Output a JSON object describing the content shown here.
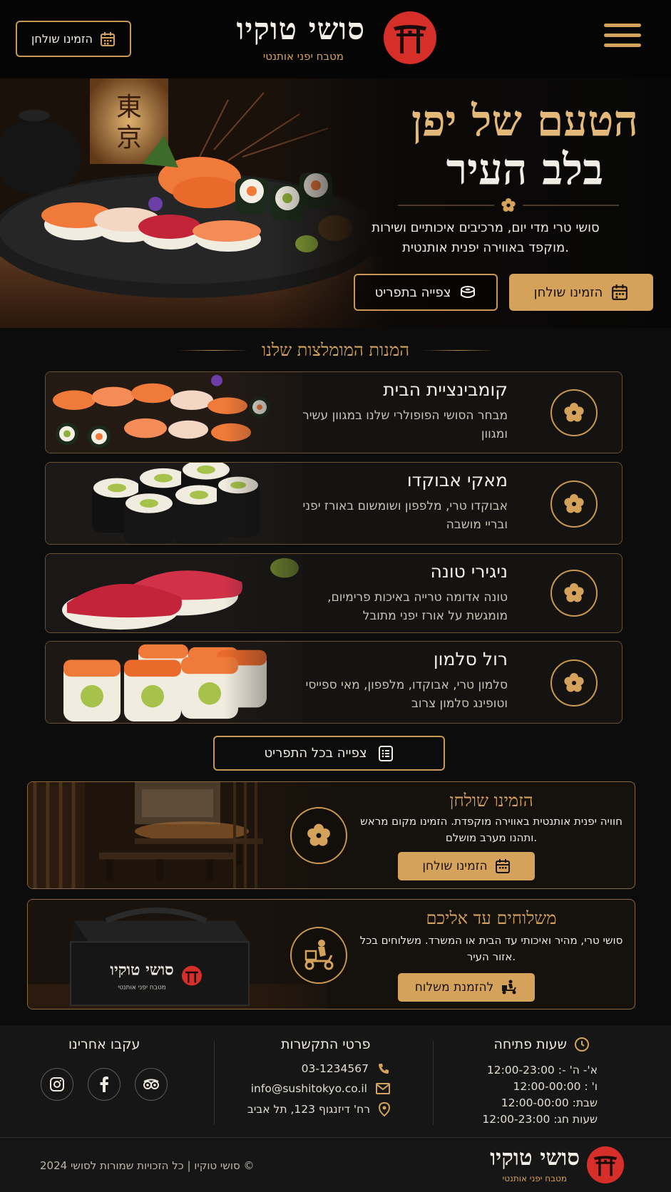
{
  "header": {
    "reserve_label": "הזמינו שולחן",
    "brand_name": "סושי טוקיו",
    "brand_tagline": "מטבח יפני אותנטי",
    "menu_icon": "hamburger-icon",
    "calendar_icon": "calendar-icon"
  },
  "hero": {
    "title_line1": "הטעם של יפן",
    "title_line2": "בלב העיר",
    "text": "סושי טרי מדי יום, מרכיבים איכותיים ושירות מוקפד באווירה יפנית אותנטית.",
    "reserve_label": "הזמינו שולחן",
    "menu_label": "צפייה בתפריט"
  },
  "featured": {
    "title": "המנות המומלצות שלנו",
    "dishes": [
      {
        "name": "קומבינציית הבית",
        "desc": "מבחר הסושי הפופולרי שלנו במגוון עשיר ומגוון"
      },
      {
        "name": "מאקי אבוקדו",
        "desc": "אבוקדו טרי, מלפפון ושומשום באורז יפני ובריי מושבה"
      },
      {
        "name": "ניגירי טונה",
        "desc": "טונה אדומה טרייה באיכות פרימיום, מומגשת על אורז יפני מתובל"
      },
      {
        "name": "רול סלמון",
        "desc": "סלמון טרי, אבוקדו, מלפפון, מאי ספייסי וטופינג סלמון צרוב"
      }
    ],
    "view_menu_label": "צפייה בכל התפריט"
  },
  "reservation": {
    "title": "הזמינו שולחן",
    "text": "חוויה יפנית אותנטית באווירה מוקפדת. הזמינו מקום מראש ותהנו מערב מושלם.",
    "button_label": "הזמינו שולחן"
  },
  "delivery": {
    "title": "משלוחים עד אליכם",
    "text": "סושי טרי, מהיר ואיכותי עד הבית או המשרד. משלוחים בכל אזור העיר.",
    "button_label": "להזמנת משלוח",
    "bag_brand": "סושי טוקיו",
    "bag_tagline": "מטבח יפני אותנטי"
  },
  "footer": {
    "hours_title": "שעות פתיחה",
    "hours": [
      "א'- ה' -: 12:00-23:00",
      "ו' : 12:00-00:00",
      "שבת: 12:00-00:00",
      "שעות חג: 12:00-23:00"
    ],
    "contact_title": "פרטי התקשרות",
    "phone": "03-1234567",
    "email": "info@sushitokyo.co.il",
    "address": "רח' דיזנגוף 123, תל אביב",
    "social_title": "עקבו אחרינו",
    "social": [
      "tripadvisor-icon",
      "facebook-icon",
      "instagram-icon"
    ],
    "copyright": "סושי טוקיו | כל הזכויות שמורות לסושי 2024 ©",
    "brand_name": "סושי טוקיו",
    "brand_tagline": "מטבח יפני אותנטי"
  },
  "colors": {
    "background": "#0c0c0c",
    "accent_gold": "#d4a25a",
    "brand_red": "#d62f2a",
    "text": "#e9e4da"
  }
}
